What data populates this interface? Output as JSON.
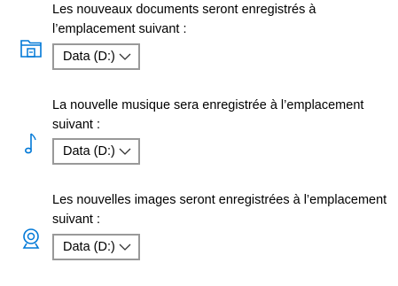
{
  "colors": {
    "accent": "#0078d7",
    "border": "#999999",
    "text": "#000000"
  },
  "sections": [
    {
      "icon": "documents-folder-icon",
      "label": "Les nouveaux documents seront enregistrés à l’emplacement suivant :",
      "selected": "Data (D:)"
    },
    {
      "icon": "music-note-icon",
      "label": "La nouvelle musique sera enregistrée à l’emplacement suivant :",
      "selected": "Data (D:)"
    },
    {
      "icon": "images-webcam-icon",
      "label": "Les nouvelles images seront enregistrées à l’emplacement suivant :",
      "selected": "Data (D:)"
    }
  ]
}
